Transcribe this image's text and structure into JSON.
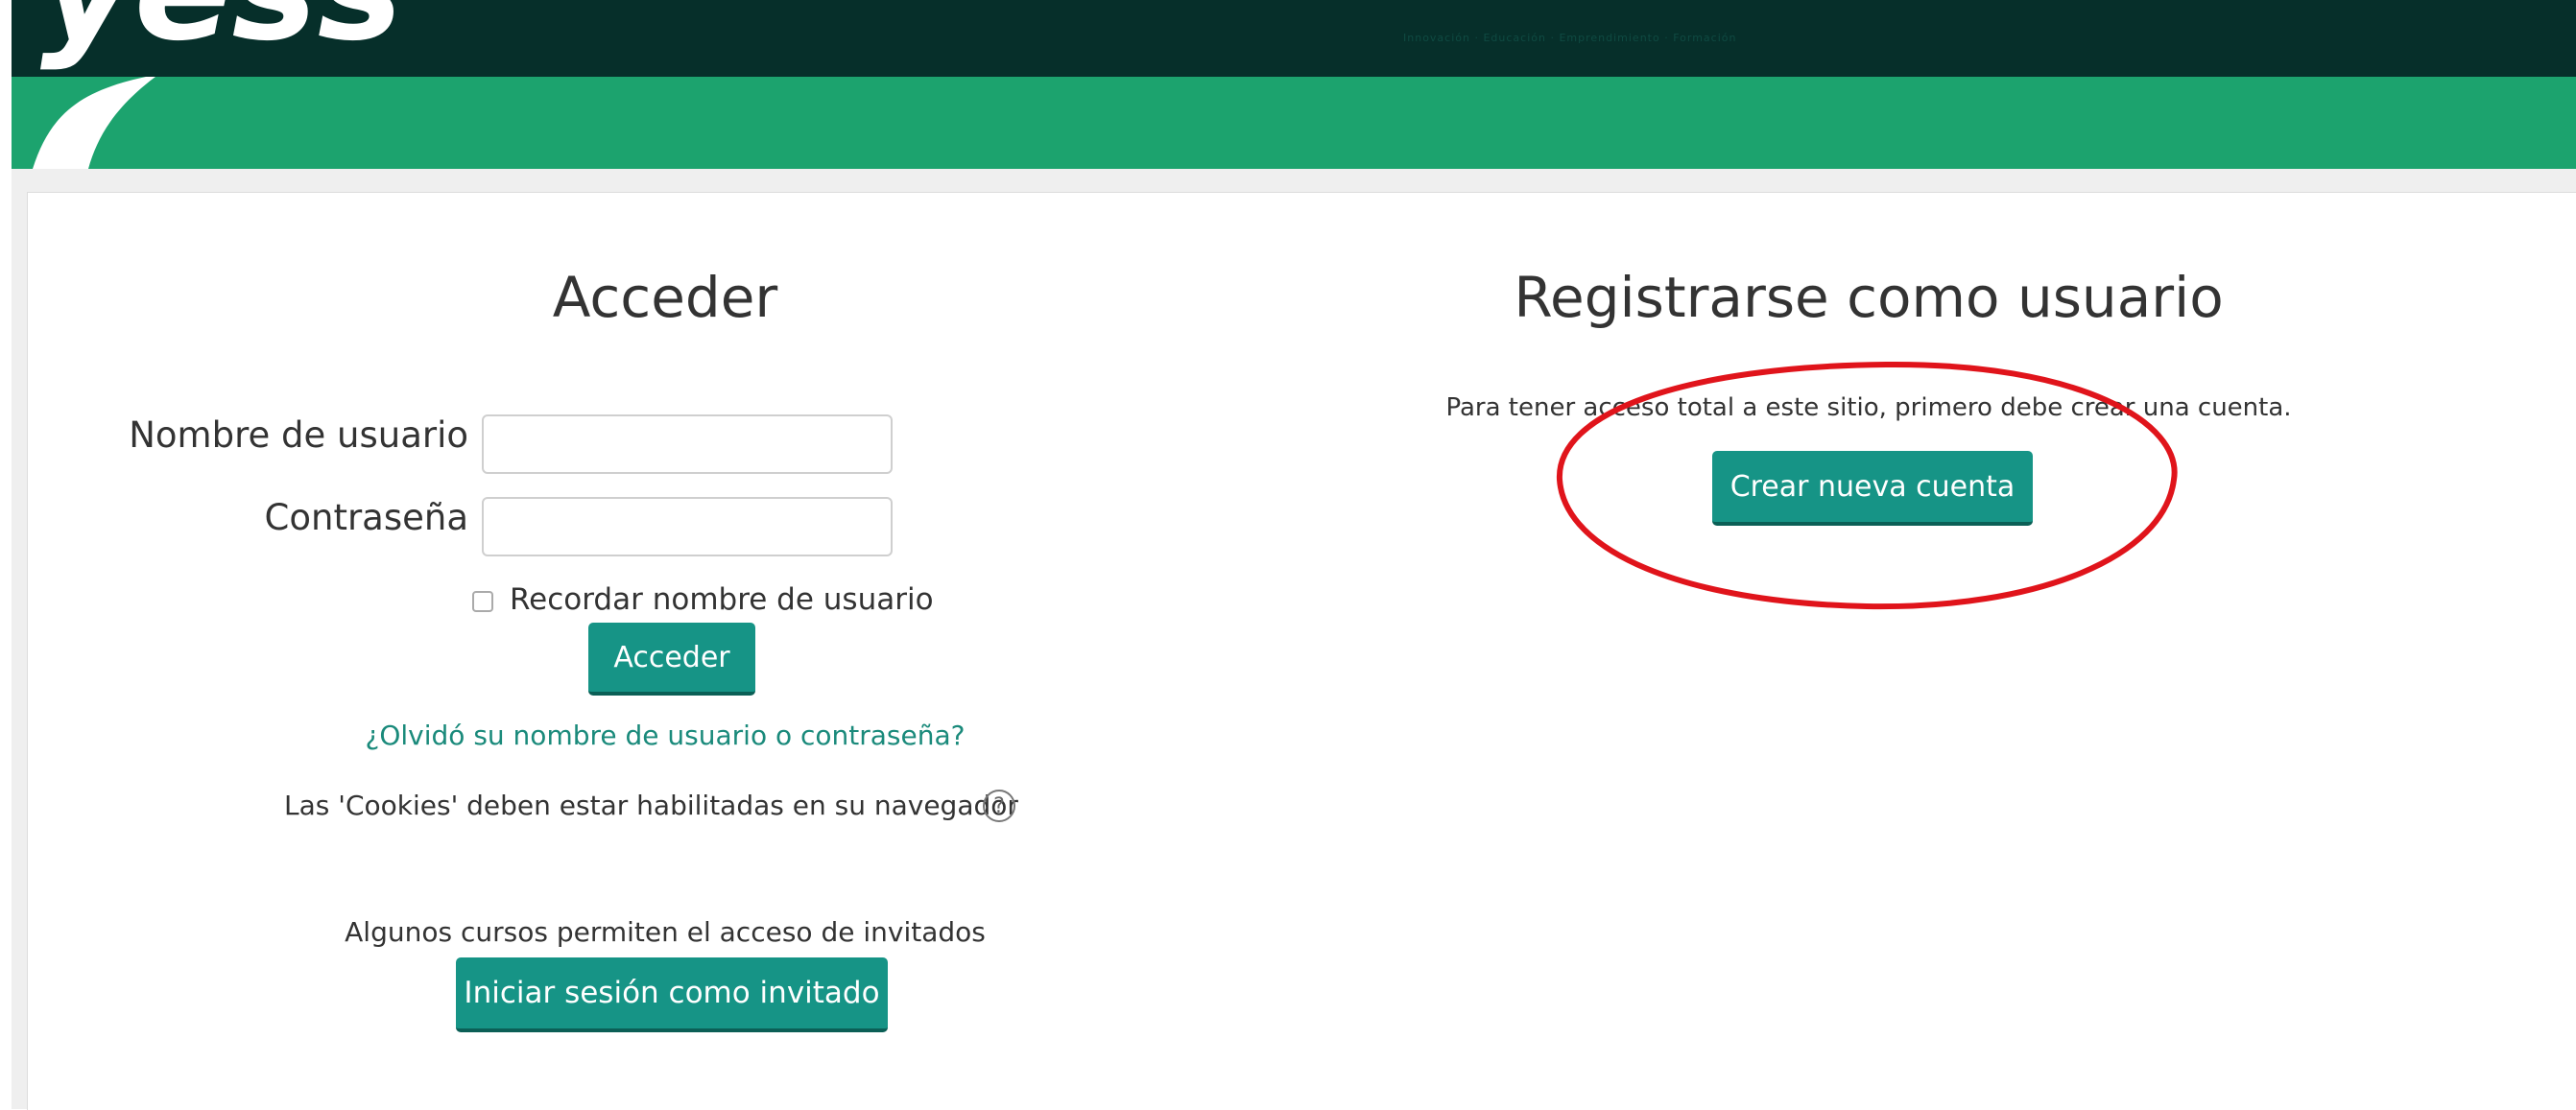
{
  "header": {
    "logo_text": "yess",
    "tagline": "Innovación · Educación · Emprendimiento · Formación"
  },
  "login": {
    "title": "Acceder",
    "username_label": "Nombre de usuario",
    "username_value": "",
    "password_label": "Contraseña",
    "password_value": "",
    "remember_label": "Recordar nombre de usuario",
    "remember_checked": false,
    "submit_label": "Acceder",
    "forgot_link": "¿Olvidó su nombre de usuario o contraseña?",
    "cookies_notice": "Las 'Cookies' deben estar habilitadas en su navegador",
    "help_icon": "question-circle-icon",
    "guest_notice": "Algunos cursos permiten el acceso de invitados",
    "guest_button": "Iniciar sesión como invitado"
  },
  "signup": {
    "title": "Registrarse como usuario",
    "description": "Para tener acceso total a este sitio, primero debe crear una cuenta.",
    "button": "Crear nueva cuenta",
    "annotation_color": "#e0141b"
  },
  "colors": {
    "header_dark": "#062f2a",
    "header_green": "#1ca36e",
    "button": "#169486",
    "link": "#1a8a7b"
  }
}
